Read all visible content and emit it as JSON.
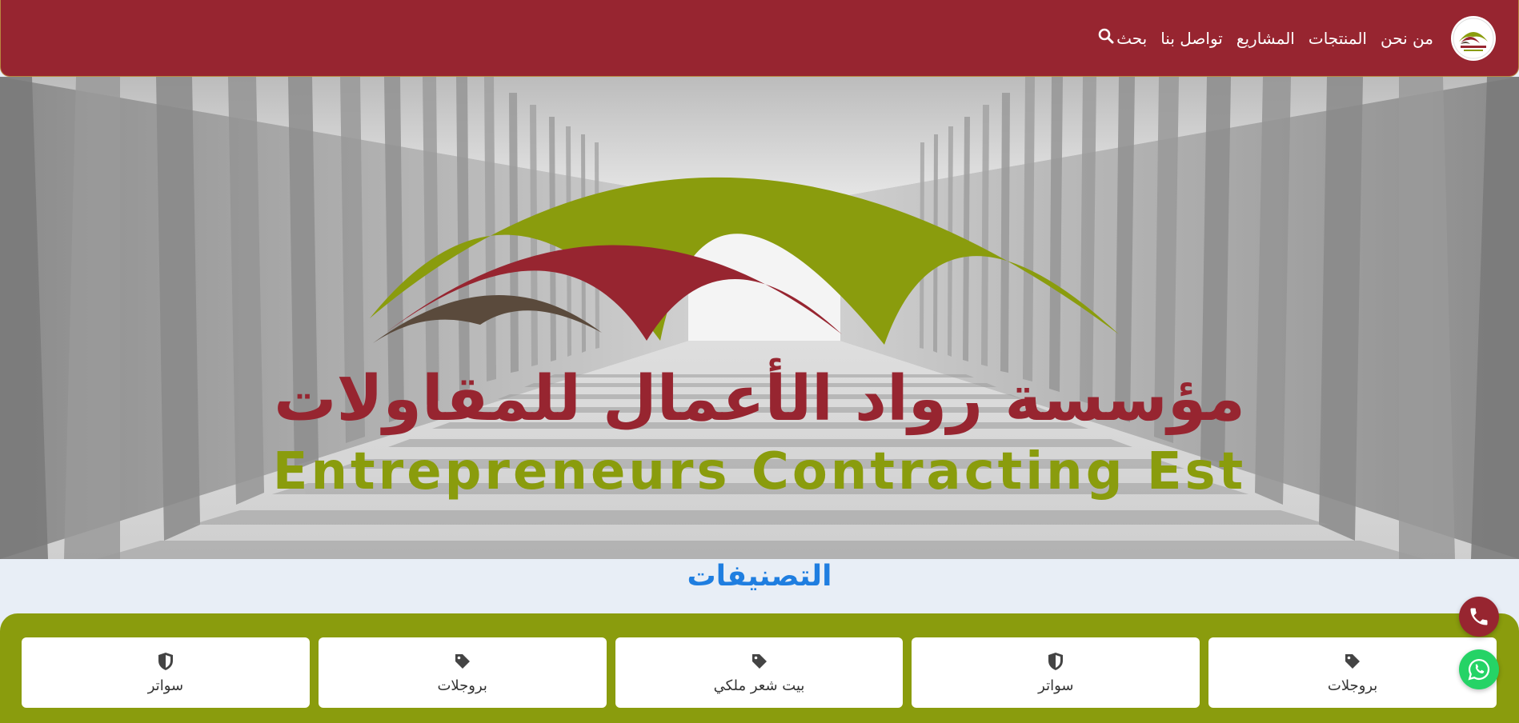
{
  "nav": {
    "links": [
      "من نحن",
      "المنتجات",
      "المشاريع",
      "تواصل بنا"
    ],
    "search_label": "بحث"
  },
  "hero": {
    "title_ar": "مؤسسة رواد الأعمال للمقاولات",
    "title_en": "Entrepreneurs Contracting Est"
  },
  "categories": {
    "title": "التصنيفات",
    "items": [
      {
        "label": "بروجلات",
        "icon": "tag-icon"
      },
      {
        "label": "سواتر",
        "icon": "shield-icon"
      },
      {
        "label": "بيت شعر ملكي",
        "icon": "tag-icon"
      },
      {
        "label": "بروجلات",
        "icon": "tag-icon"
      },
      {
        "label": "سواتر",
        "icon": "shield-icon"
      }
    ]
  },
  "colors": {
    "primary": "#972530",
    "accent_green": "#8a9c0d",
    "title_blue": "#1f7ee0",
    "whatsapp": "#25d366"
  }
}
